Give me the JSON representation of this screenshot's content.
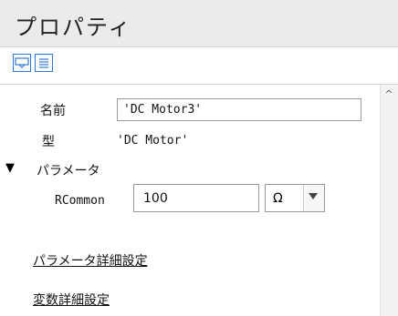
{
  "panel": {
    "title": "プロパティ"
  },
  "toolbar": {
    "buttons": [
      {
        "icon": "property-view-icon"
      },
      {
        "icon": "list-view-icon"
      }
    ],
    "accent_color": "#2f7ad0"
  },
  "properties": {
    "name_label": "名前",
    "name_value": "'DC Motor3'",
    "type_label": "型",
    "type_value": "'DC Motor'"
  },
  "parameters": {
    "toggle_glyph": "▼",
    "section_label": "パラメータ",
    "rows": [
      {
        "name": "RCommon",
        "value": "100",
        "unit": "Ω"
      }
    ]
  },
  "links": {
    "param_detail": "パラメータ詳細設定",
    "var_detail": "変数詳細設定"
  },
  "scrollbar": {
    "up_glyph": "^"
  }
}
